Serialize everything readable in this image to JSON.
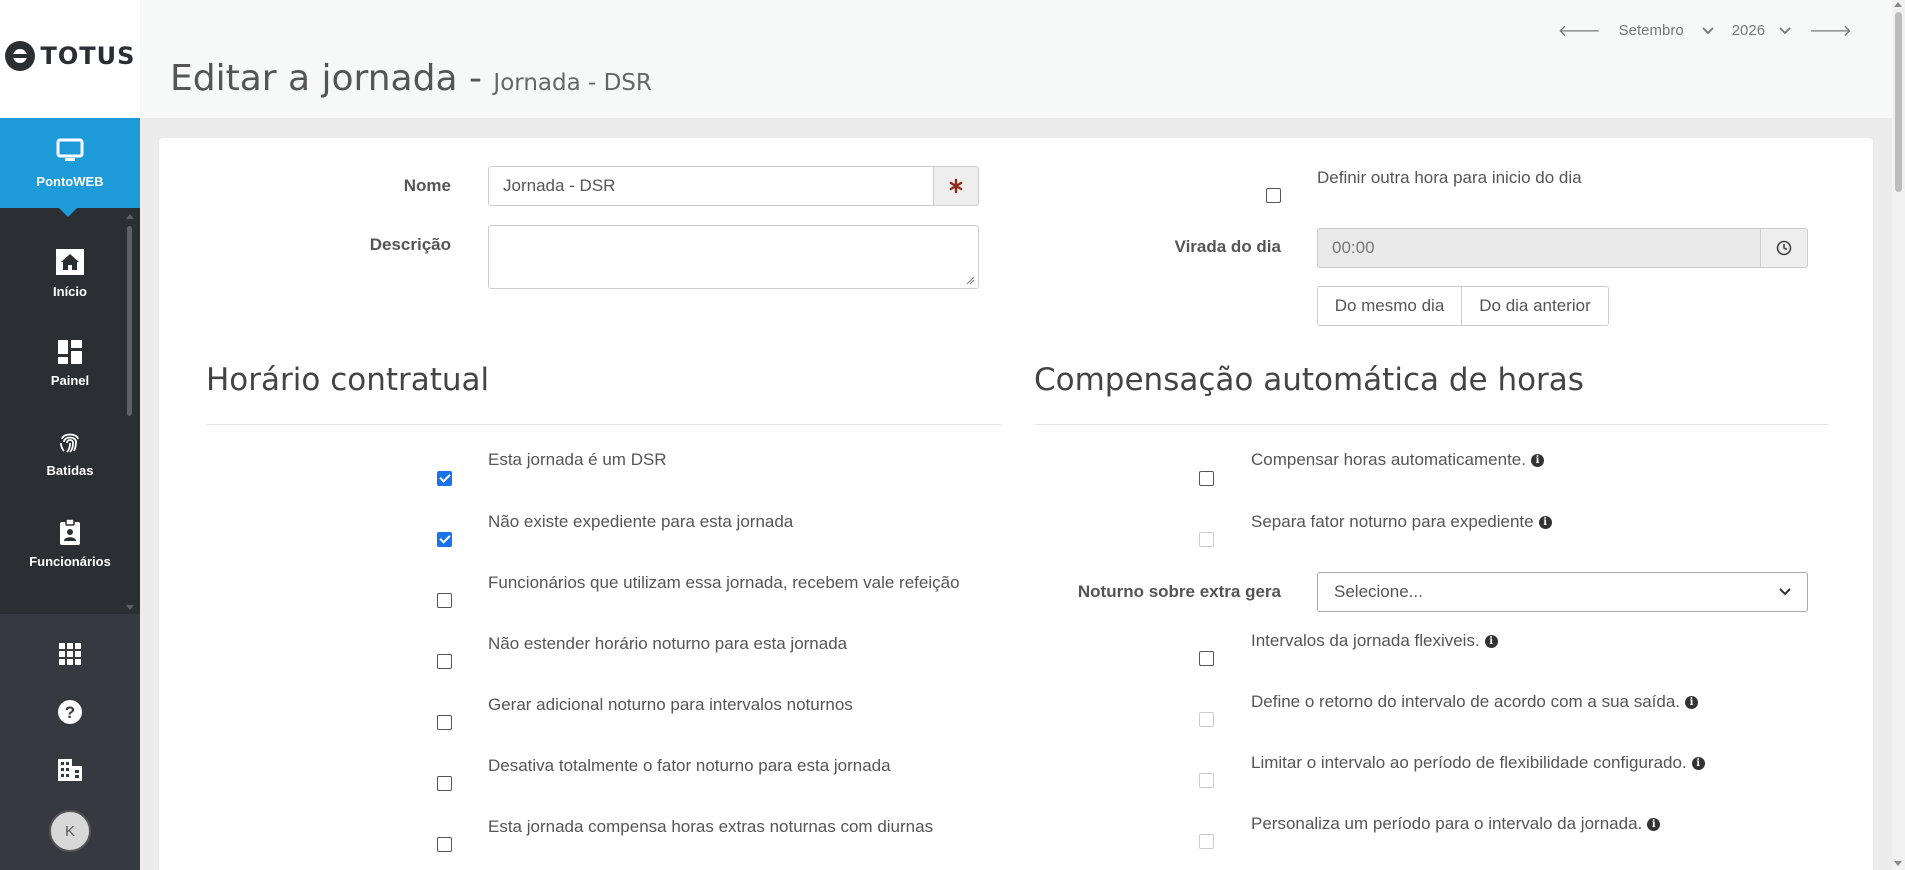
{
  "brand": {
    "logo_text": "TOTUS"
  },
  "sidebar": {
    "active": {
      "label": "PontoWEB",
      "icon": "monitor-icon"
    },
    "items": [
      {
        "label": "Início",
        "icon": "home-icon"
      },
      {
        "label": "Painel",
        "icon": "dashboard-icon"
      },
      {
        "label": "Batidas",
        "icon": "fingerprint-icon"
      },
      {
        "label": "Funcionários",
        "icon": "badge-icon"
      }
    ],
    "bottom": {
      "apps_icon": "grid-icon",
      "help_icon": "help-icon",
      "company_icon": "building-icon",
      "avatar_initial": "K"
    }
  },
  "header": {
    "title": "Editar a jornada -",
    "subtitle": "Jornada - DSR",
    "month": "Setembro",
    "year": "2026"
  },
  "form": {
    "nome_label": "Nome",
    "nome_value": "Jornada - DSR",
    "descricao_label": "Descrição",
    "descricao_value": "",
    "outra_hora_label": "Definir outra hora para inicio do dia",
    "virada_label": "Virada do dia",
    "virada_value": "00:00",
    "btn_mesmo_dia": "Do mesmo dia",
    "btn_dia_anterior": "Do dia anterior"
  },
  "horario": {
    "title": "Horário contratual",
    "options": [
      {
        "label": "Esta jornada é um DSR",
        "checked": true
      },
      {
        "label": "Não existe expediente para esta jornada",
        "checked": true
      },
      {
        "label": "Funcionários que utilizam essa jornada, recebem vale refeição",
        "checked": false
      },
      {
        "label": "Não estender horário noturno para esta jornada",
        "checked": false
      },
      {
        "label": "Gerar adicional noturno para intervalos noturnos",
        "checked": false
      },
      {
        "label": "Desativa totalmente o fator noturno para esta jornada",
        "checked": false
      },
      {
        "label": "Esta jornada compensa horas extras noturnas com diurnas",
        "checked": false
      }
    ]
  },
  "compensacao": {
    "title": "Compensação automática de horas",
    "options": [
      {
        "label": "Compensar horas automaticamente.",
        "checked": false,
        "disabled": false
      },
      {
        "label": "Separa fator noturno para expediente",
        "checked": false,
        "disabled": true
      }
    ],
    "noturno_label": "Noturno sobre extra gera",
    "noturno_value": "Selecione...",
    "options2": [
      {
        "label": "Intervalos da jornada flexiveis.",
        "checked": false,
        "disabled": false
      },
      {
        "label": "Define o retorno do intervalo de acordo com a sua saída.",
        "checked": false,
        "disabled": true
      },
      {
        "label": "Limitar o intervalo ao período de flexibilidade configurado.",
        "checked": false,
        "disabled": true
      },
      {
        "label": "Personaliza um período para o intervalo da jornada.",
        "checked": false,
        "disabled": true
      }
    ]
  },
  "colors": {
    "accent": "#1d9ad8",
    "sidebar": "#2b2e33",
    "required": "#8b2b1a"
  }
}
